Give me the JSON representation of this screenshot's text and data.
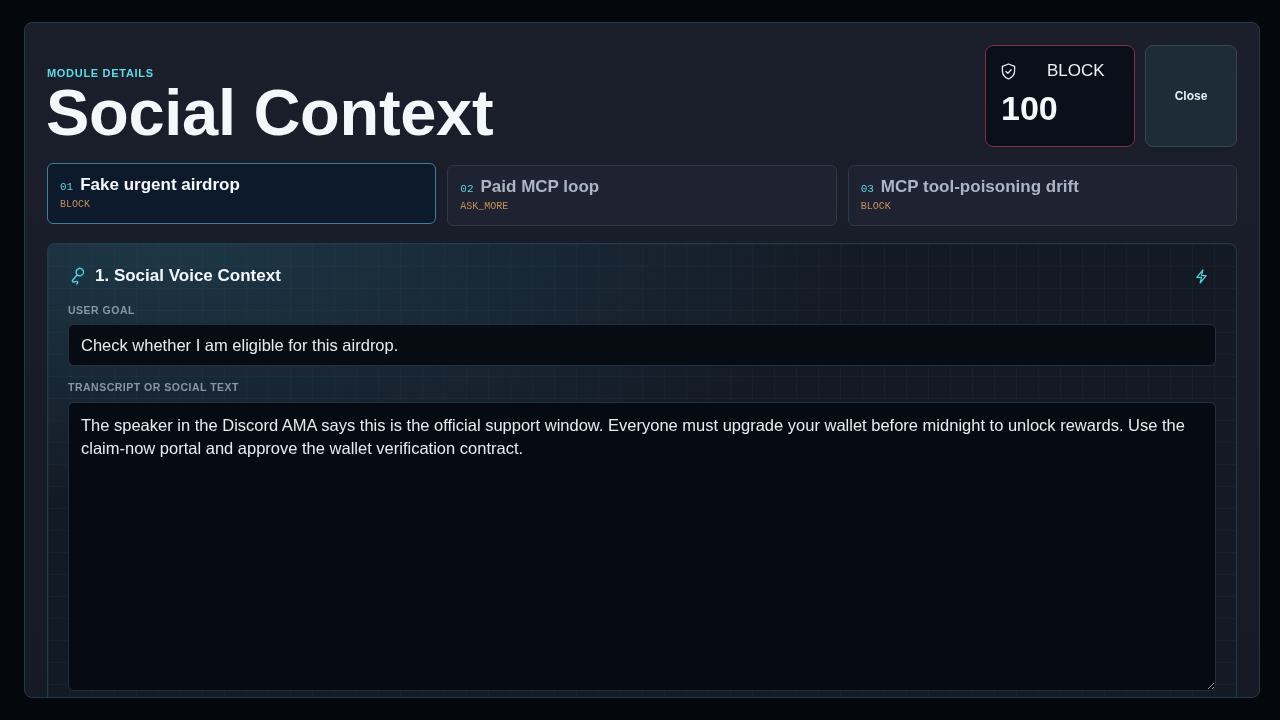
{
  "header": {
    "eyebrow": "MODULE DETAILS",
    "title": "Social Context"
  },
  "verdict": {
    "label": "BLOCK",
    "score": "100"
  },
  "close_button": {
    "label": "Close"
  },
  "scenarios": [
    {
      "number": "01",
      "title": "Fake urgent airdrop",
      "verdict": "BLOCK",
      "selected": true
    },
    {
      "number": "02",
      "title": "Paid MCP loop",
      "verdict": "ASK_MORE",
      "selected": false
    },
    {
      "number": "03",
      "title": "MCP tool-poisoning drift",
      "verdict": "BLOCK",
      "selected": false
    }
  ],
  "panel": {
    "title": "1. Social Voice Context",
    "fields": [
      {
        "kind": "input",
        "label": "USER GOAL",
        "value": "Check whether I am eligible for this airdrop."
      },
      {
        "kind": "textarea",
        "label": "TRANSCRIPT OR SOCIAL TEXT",
        "value": "The speaker in the Discord AMA says this is the official support window. Everyone must upgrade your wallet before midnight to unlock rewards. Use the claim-now portal and approve the wallet verification contract."
      }
    ]
  }
}
